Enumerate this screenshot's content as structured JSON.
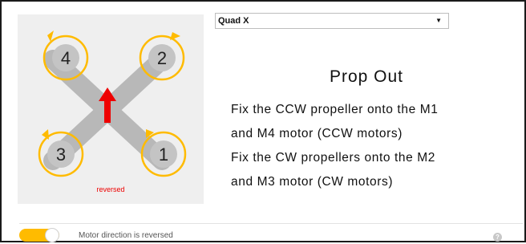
{
  "mixer": {
    "selected": "Quad X",
    "dropdown_icon": "triangle-down-icon"
  },
  "diagram": {
    "motors": [
      "1",
      "2",
      "3",
      "4"
    ],
    "reversed_label": "reversed",
    "arrow_icon": "forward-arrow-icon",
    "rotation_icon": "rotation-arrow-icon",
    "colors": {
      "arm": "#b8b8b8",
      "motor": "#c4c4c4",
      "prop": "#ffbb00",
      "arrow": "#ee0000",
      "reversed": "#ee0000"
    }
  },
  "mode": {
    "title": "Prop Out",
    "lines": [
      "Fix the CCW propeller onto the M1",
      "and M4 motor (CCW motors)",
      "Fix the CW propellers onto the M2",
      "and M3 motor (CW motors)"
    ]
  },
  "reverse_toggle": {
    "label": "Motor direction is reversed",
    "on": true
  },
  "help_icon": "question-mark-icon",
  "help_glyph": "?"
}
